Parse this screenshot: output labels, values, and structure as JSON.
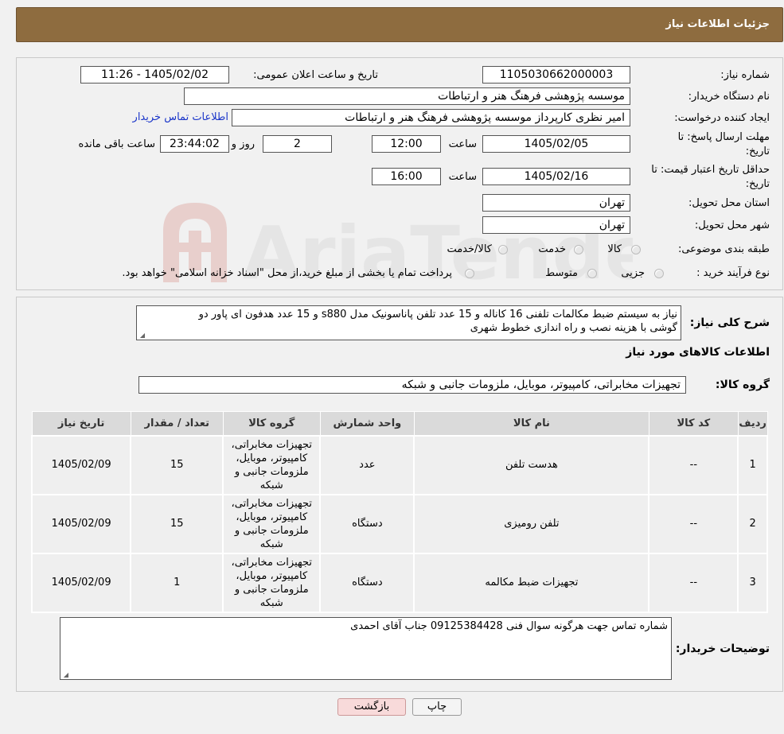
{
  "header": {
    "title": "جزئیات اطلاعات نیاز"
  },
  "watermark_text": "AriaTender.neT",
  "info": {
    "need_number_label": "شماره نیاز:",
    "need_number": "1105030662000003",
    "announce_label": "تاریخ و ساعت اعلان عمومی:",
    "announce_value": "1405/02/02 - 11:26",
    "buyer_org_label": "نام دستگاه خریدار:",
    "buyer_org": "موسسه پژوهشی فرهنگ  هنر و ارتباطات",
    "creator_label": "ایجاد کننده درخواست:",
    "creator": "امیر نظری کارپرداز موسسه پژوهشی فرهنگ  هنر و ارتباطات",
    "contact_link": "اطلاعات تماس خریدار",
    "deadline_label_1": "مهلت ارسال پاسخ: تا",
    "deadline_label_2": "تاریخ:",
    "deadline_date": "1405/02/05",
    "time_label": "ساعت",
    "deadline_time": "12:00",
    "days_value": "2",
    "days_label": "روز و",
    "remaining_time": "23:44:02",
    "remaining_label": "ساعت باقی مانده",
    "validity_label_1": "حداقل تاریخ اعتبار قیمت: تا",
    "validity_label_2": "تاریخ:",
    "validity_date": "1405/02/16",
    "validity_time": "16:00",
    "province_label": "استان محل تحویل:",
    "province": "تهران",
    "city_label": "شهر محل تحویل:",
    "city": "تهران",
    "category_label": "طبقه بندی موضوعی:",
    "category_options": [
      "کالا",
      "خدمت",
      "کالا/خدمت"
    ],
    "process_label": "نوع فرآیند خرید :",
    "process_options": [
      "جزیی",
      "متوسط"
    ],
    "process_note": "پرداخت تمام یا بخشی از مبلغ خرید،از محل \"اسناد خزانه اسلامی\" خواهد بود."
  },
  "details": {
    "summary_label": "شرح کلی نیاز:",
    "summary_line1": "نیاز به سیستم ضبط مکالمات تلفنی 16 کاناله و 15 عدد تلفن پاناسونیک مدل s880 و 15 عدد هدفون ای پاور دو",
    "summary_line2": "گوشی با هزینه نصب و راه اندازی خطوط شهری",
    "goods_info_title": "اطلاعات کالاهای مورد نیاز",
    "goods_group_label": "گروه کالا:",
    "goods_group": "تجهیزات مخابراتی، کامپیوتر، موبایل، ملزومات جانبی و شبکه"
  },
  "table": {
    "headers": [
      "ردیف",
      "کد کالا",
      "نام کالا",
      "واحد شمارش",
      "گروه کالا",
      "تعداد / مقدار",
      "تاریخ نیاز"
    ],
    "rows": [
      {
        "row": "1",
        "code": "--",
        "name": "هدست تلفن",
        "unit": "عدد",
        "group": "تجهیزات مخابراتی، کامپیوتر، موبایل، ملزومات جانبی و شبکه",
        "qty": "15",
        "date": "1405/02/09"
      },
      {
        "row": "2",
        "code": "--",
        "name": "تلفن رومیزی",
        "unit": "دستگاه",
        "group": "تجهیزات مخابراتی، کامپیوتر، موبایل، ملزومات جانبی و شبکه",
        "qty": "15",
        "date": "1405/02/09"
      },
      {
        "row": "3",
        "code": "--",
        "name": "تجهیزات ضبط مکالمه",
        "unit": "دستگاه",
        "group": "تجهیزات مخابراتی، کامپیوتر، موبایل، ملزومات جانبی و شبکه",
        "qty": "1",
        "date": "1405/02/09"
      }
    ]
  },
  "buyer_notes": {
    "label": "توضیحات خریدار:",
    "text": "شماره تماس جهت هرگونه سوال فنی  09125384428 جناب آقای احمدی"
  },
  "buttons": {
    "print": "چاپ",
    "back": "بازگشت"
  },
  "colors": {
    "header_bg": "#8e6c3f",
    "link": "#1a35c9",
    "back_button_bg": "#f8dada"
  }
}
